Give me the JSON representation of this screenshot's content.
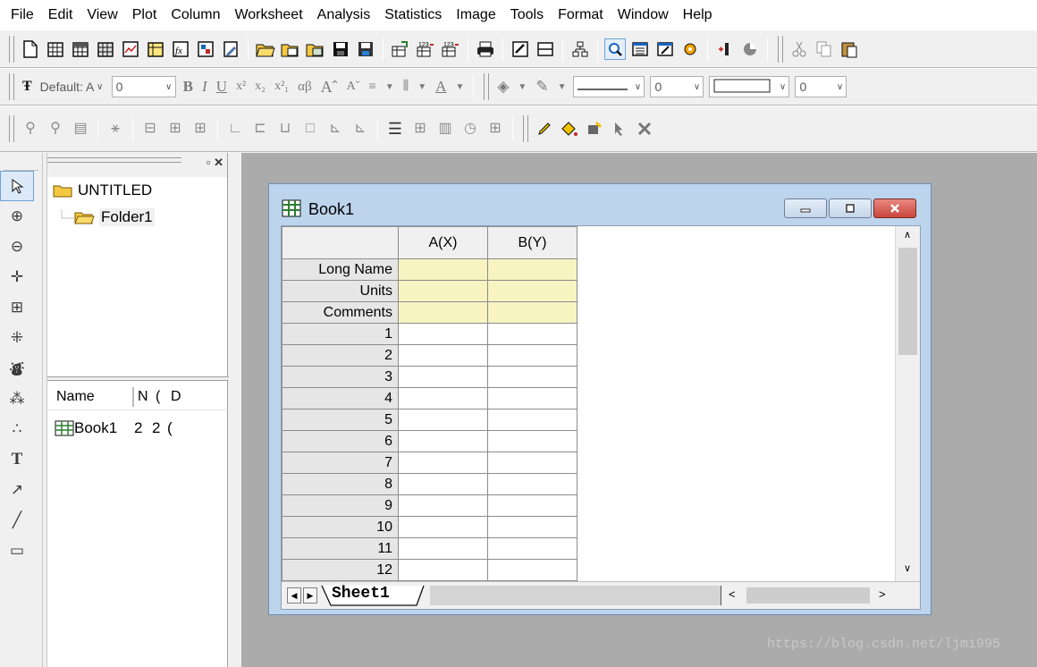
{
  "menu": [
    "File",
    "Edit",
    "View",
    "Plot",
    "Column",
    "Worksheet",
    "Analysis",
    "Statistics",
    "Image",
    "Tools",
    "Format",
    "Window",
    "Help"
  ],
  "format_toolbar": {
    "font_label": "Default: A",
    "font_size": "0",
    "bold": "B",
    "italic": "I",
    "underline": "U",
    "line_width": "0",
    "border_width": "0"
  },
  "explorer": {
    "root": "UNTITLED",
    "folder": "Folder1",
    "list_headers": [
      "Name",
      "N",
      "(",
      "D"
    ],
    "list_row": {
      "name": "Book1",
      "c1": "2",
      "c2": "2",
      "c3": "("
    }
  },
  "book": {
    "title": "Book1",
    "columns": [
      "A(X)",
      "B(Y)"
    ],
    "header_rows": [
      "Long Name",
      "Units",
      "Comments"
    ],
    "row_numbers": [
      "1",
      "2",
      "3",
      "4",
      "5",
      "6",
      "7",
      "8",
      "9",
      "10",
      "11",
      "12"
    ],
    "sheet_tab": "Sheet1"
  },
  "watermark": "https://blog.csdn.net/ljmi995",
  "colors": {
    "workspace": "#ababab",
    "header_cell": "#f7f4c2",
    "window_frame": "#bcd4ec",
    "close_button": "#c9463d"
  }
}
